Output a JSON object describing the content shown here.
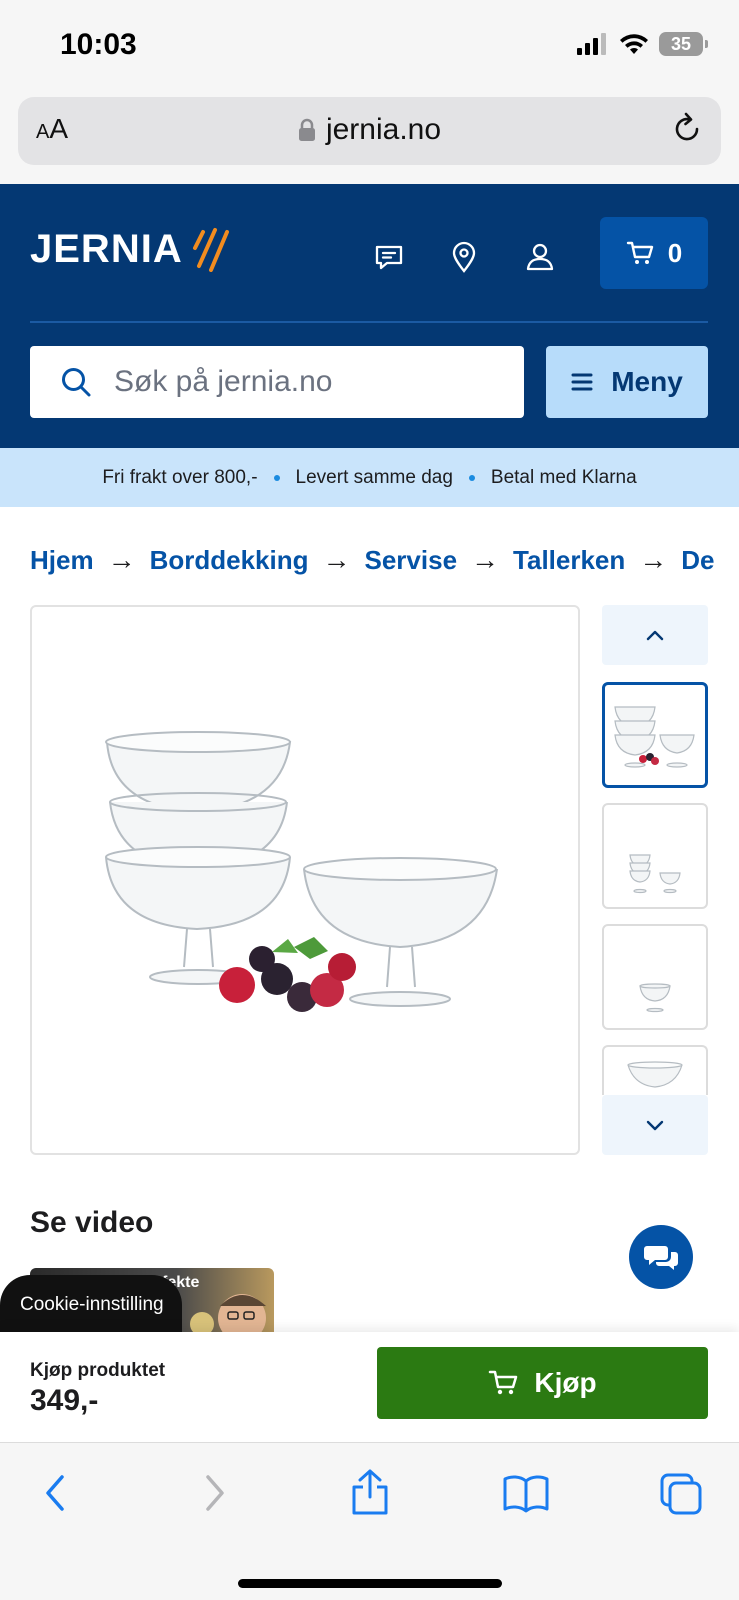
{
  "status_bar": {
    "time": "10:03",
    "battery": "35"
  },
  "browser": {
    "aa_label_small": "A",
    "aa_label_large": "A",
    "url": "jernia.no"
  },
  "header": {
    "logo_text": "JERNIA",
    "cart_count": "0",
    "search_placeholder": "Søk på jernia.no",
    "menu_label": "Meny",
    "brand_color": "#043873",
    "accent_color": "#f28c1f"
  },
  "usp": [
    "Fri frakt over 800,-",
    "Levert samme dag",
    "Betal med Klarna"
  ],
  "breadcrumb": [
    "Hjem",
    "Borddekking",
    "Servise",
    "Tallerken",
    "De"
  ],
  "product": {
    "video_heading": "Se video",
    "video_overlay_text": "fekte",
    "cookie_label": "Cookie-innstilling",
    "buy_label": "Kjøp produktet",
    "price": "349,-",
    "buy_button": "Kjøp",
    "buy_color": "#2b7a12"
  },
  "icons": {
    "header": [
      "chat-icon",
      "location-pin-icon",
      "user-icon",
      "cart-icon"
    ],
    "toolbar": [
      "back-icon",
      "forward-icon",
      "share-icon",
      "bookmarks-icon",
      "tabs-icon"
    ]
  }
}
